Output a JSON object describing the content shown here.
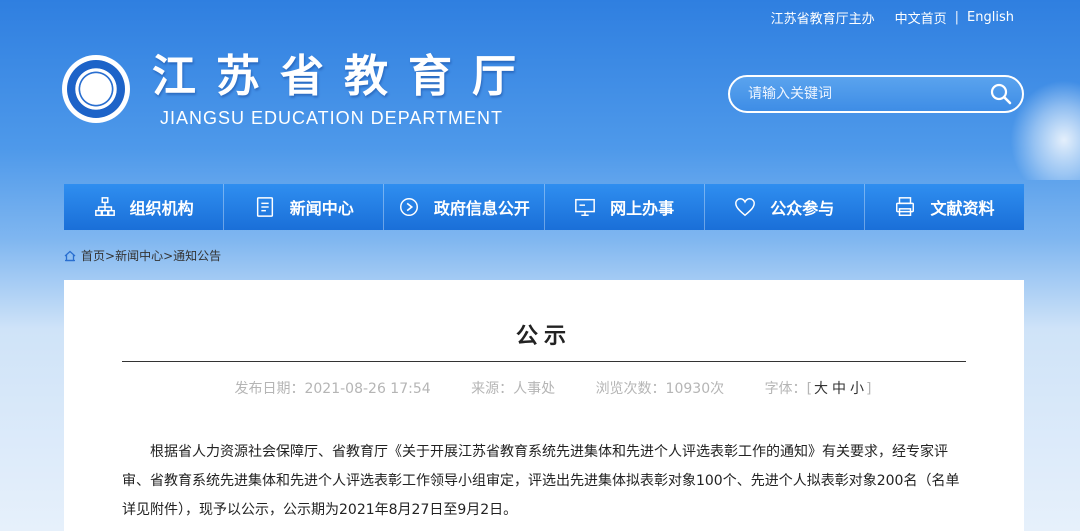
{
  "toplinks": {
    "host": "江苏省教育厅主办",
    "chinese": "中文首页",
    "separator": "|",
    "english": "English"
  },
  "header": {
    "title": "江苏省教育厅",
    "subtitle": "JIANGSU EDUCATION DEPARTMENT",
    "logo_icon": "jiangsu-education-emblem"
  },
  "search": {
    "placeholder": "请输入关键词",
    "icon": "search-icon"
  },
  "nav": {
    "items": [
      {
        "label": "组织机构",
        "icon": "org-chart-icon"
      },
      {
        "label": "新闻中心",
        "icon": "document-icon"
      },
      {
        "label": "政府信息公开",
        "icon": "circle-play-icon"
      },
      {
        "label": "网上办事",
        "icon": "monitor-icon"
      },
      {
        "label": "公众参与",
        "icon": "heart-icon"
      },
      {
        "label": "文献资料",
        "icon": "printer-icon"
      }
    ]
  },
  "breadcrumb": {
    "home": "首页",
    "news": "新闻中心",
    "current": "通知公告",
    "sep": ">"
  },
  "article": {
    "title": "公示",
    "publish_date": "发布日期：2021-08-26 17:54",
    "source": "来源：人事处",
    "views": "浏览次数：10930次",
    "font_size_label": "字体：",
    "size_open": "[",
    "size_large": "大",
    "size_medium": "中",
    "size_small": "小",
    "size_close": "]",
    "body": "根据省人力资源社会保障厅、省教育厅《关于开展江苏省教育系统先进集体和先进个人评选表彰工作的通知》有关要求，经专家评审、省教育系统先进集体和先进个人评选表彰工作领导小组审定，评选出先进集体拟表彰对象100个、先进个人拟表彰对象200名（名单详见附件），现予以公示，公示期为2021年8月27日至9月2日。"
  },
  "colors": {
    "nav_bg": "#1a6fd8",
    "sky_top": "#2f7fe0",
    "text": "#222222",
    "meta": "#b5b5b5"
  }
}
